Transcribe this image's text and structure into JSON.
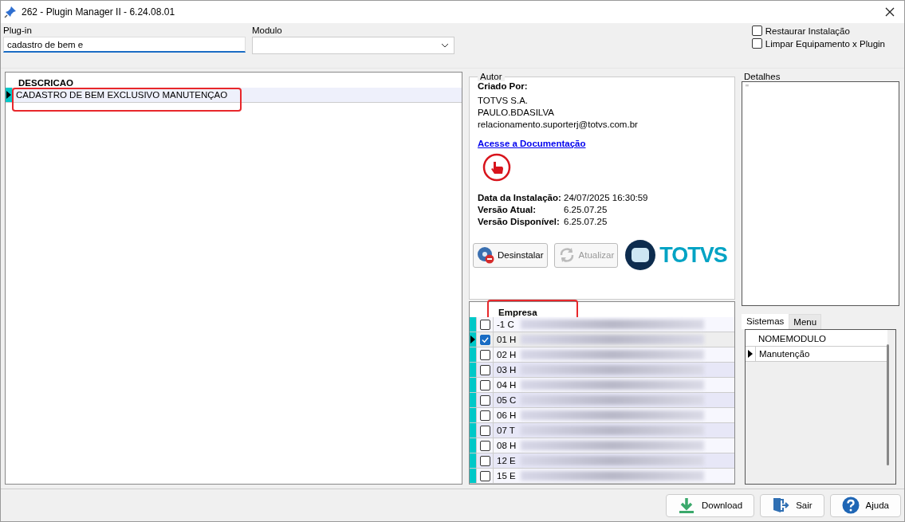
{
  "window": {
    "title": "262 - Plugin Manager II - 6.24.08.01"
  },
  "filters": {
    "plugin": {
      "label": "Plug-in",
      "value": "cadastro de bem e"
    },
    "modulo": {
      "label": "Modulo"
    }
  },
  "options": [
    {
      "label": "Restaurar Instalação",
      "checked": false
    },
    {
      "label": "Limpar Equipamento x Plugin",
      "checked": false
    }
  ],
  "plugins": {
    "column": "DESCRICAO",
    "rows": [
      {
        "descricao": "CADASTRO DE BEM EXCLUSIVO MANUTENÇAO",
        "selected": true,
        "highlighted": true
      }
    ]
  },
  "author": {
    "legend": "Autor",
    "created_by_label": "Criado Por:",
    "lines": [
      "TOTVS S.A.",
      "PAULO.BDASILVA",
      "relacionamento.suporterj@totvs.com.br"
    ],
    "doc_link": "Acesse a Documentação",
    "info": [
      {
        "label": "Data da Instalação:",
        "value": "24/07/2025 16:30:59"
      },
      {
        "label": "Versão Atual:",
        "value": "6.25.07.25"
      },
      {
        "label": "Versão Disponível:",
        "value": "6.25.07.25"
      }
    ]
  },
  "actions": [
    {
      "label": "Desinstalar",
      "kind": "uninstall",
      "disabled": false
    },
    {
      "label": "Atualizar",
      "kind": "update",
      "disabled": true
    }
  ],
  "logo": {
    "text": "TOTVS"
  },
  "companies": {
    "column": "Empresa",
    "header_highlighted": true,
    "rows": [
      {
        "code": "-1 C",
        "checked": false,
        "selected": false
      },
      {
        "code": "01 H",
        "checked": true,
        "selected": true
      },
      {
        "code": "02 H",
        "checked": false,
        "selected": false
      },
      {
        "code": "03 H",
        "checked": false,
        "selected": false
      },
      {
        "code": "04 H",
        "checked": false,
        "selected": false
      },
      {
        "code": "05 C",
        "checked": false,
        "selected": false
      },
      {
        "code": "06 H",
        "checked": false,
        "selected": false
      },
      {
        "code": "07 T",
        "checked": false,
        "selected": false
      },
      {
        "code": "08 H",
        "checked": false,
        "selected": false
      },
      {
        "code": "12 E",
        "checked": false,
        "selected": false
      },
      {
        "code": "15 E",
        "checked": false,
        "selected": false
      }
    ]
  },
  "details": {
    "legend": "Detalhes",
    "text": "''"
  },
  "side_tabs": [
    {
      "label": "Sistemas",
      "selected": true
    },
    {
      "label": "Menu",
      "selected": false
    }
  ],
  "modules": {
    "column": "NOMEMODULO",
    "rows": [
      {
        "name": "Manutenção",
        "selected": true
      }
    ]
  },
  "buttons": [
    {
      "label": "Download",
      "kind": "download"
    },
    {
      "label": "Sair",
      "kind": "exit"
    },
    {
      "label": "Ajuda",
      "kind": "help"
    }
  ]
}
